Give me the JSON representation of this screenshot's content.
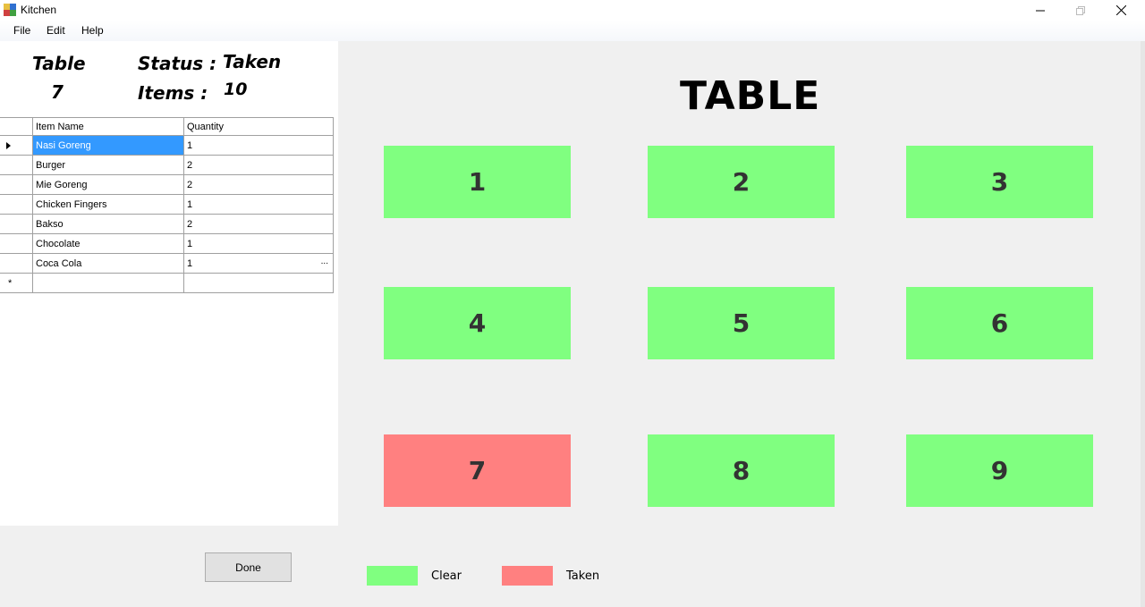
{
  "window": {
    "title": "Kitchen"
  },
  "menu": {
    "file": "File",
    "edit": "Edit",
    "help": "Help"
  },
  "info": {
    "table_label": "Table",
    "table_number": "7",
    "status_label": "Status :",
    "status_value": "Taken",
    "items_label": "Items :",
    "items_value": "10"
  },
  "grid": {
    "headers": [
      "Item Name",
      "Quantity"
    ],
    "rows": [
      {
        "name": "Nasi Goreng",
        "qty": "1"
      },
      {
        "name": "Burger",
        "qty": "2"
      },
      {
        "name": "Mie Goreng",
        "qty": "2"
      },
      {
        "name": "Chicken Fingers",
        "qty": "1"
      },
      {
        "name": "Bakso",
        "qty": "2"
      },
      {
        "name": "Chocolate",
        "qty": "1"
      },
      {
        "name": "Coca Cola",
        "qty": "1"
      }
    ],
    "ellipsis": "..."
  },
  "done_label": "Done",
  "header_title": "TABLE",
  "tables": [
    {
      "label": "1",
      "status": "clear"
    },
    {
      "label": "2",
      "status": "clear"
    },
    {
      "label": "3",
      "status": "clear"
    },
    {
      "label": "4",
      "status": "clear"
    },
    {
      "label": "5",
      "status": "clear"
    },
    {
      "label": "6",
      "status": "clear"
    },
    {
      "label": "7",
      "status": "taken"
    },
    {
      "label": "8",
      "status": "clear"
    },
    {
      "label": "9",
      "status": "clear"
    }
  ],
  "legend": {
    "clear": "Clear",
    "taken": "Taken"
  },
  "colors": {
    "clear": "#80ff80",
    "taken": "#ff8080",
    "selected_row": "#3399ff"
  }
}
